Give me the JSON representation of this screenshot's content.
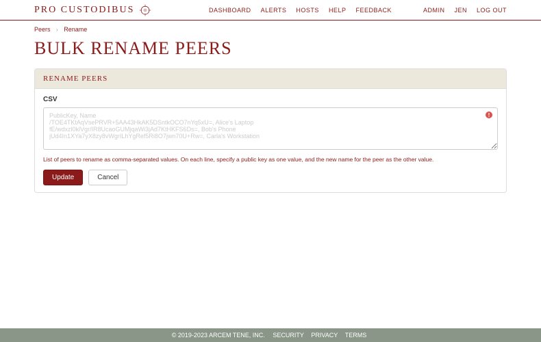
{
  "brand": "PRO CUSTODIBUS",
  "nav": {
    "dashboard": "DASHBOARD",
    "alerts": "ALERTS",
    "hosts": "HOSTS",
    "help": "HELP",
    "feedback": "FEEDBACK",
    "admin": "ADMIN",
    "user": "JEN",
    "logout": "LOG OUT"
  },
  "breadcrumb": {
    "peers": "Peers",
    "rename": "Rename"
  },
  "page_title": "BULK RENAME PEERS",
  "card": {
    "header": "RENAME PEERS",
    "csv_label": "CSV",
    "csv_placeholder": "PublicKey, Name\n/TOE4TKtAqVsePRVR+5AA43HkAK5DSntkOCO7nYq5xU=, Alice's Laptop\nfE/wdxzl0klVgr/IR8UcaoGUMjqaWi3jAd7KtHKFS6Ds=, Bob's Phone\njUd4In1XYa7yX8zy8vWgrILhYgRef5Ri8O7jwn70U+Rw=, Carla's Workstation",
    "csv_value": "",
    "help_text": "List of peers to rename as comma-separated values. On each line, specify a public key as one value, and the new name for the peer as the other value.",
    "update_label": "Update",
    "cancel_label": "Cancel"
  },
  "footer": {
    "copyright": "© 2019-2023 ARCEM TENE, INC.",
    "security": "SECURITY",
    "privacy": "PRIVACY",
    "terms": "TERMS"
  }
}
